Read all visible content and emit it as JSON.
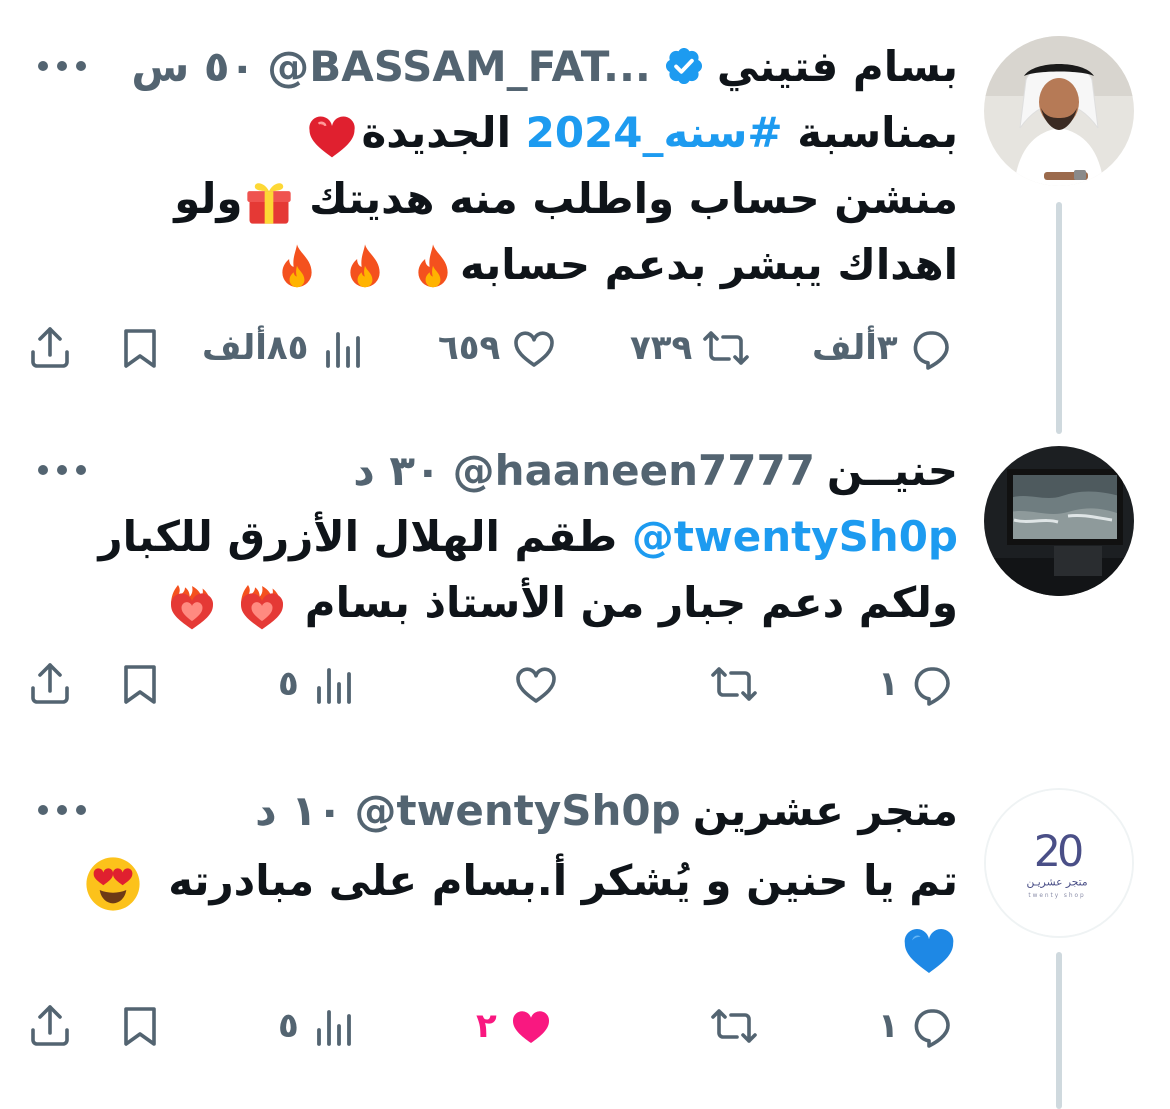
{
  "tweets": [
    {
      "name": "بسام فتيني",
      "handle": "@BASSAM_FAT...",
      "time": "٥٠ س",
      "line1_a": "بمناسبة ",
      "line1_link": "#سنه_2024",
      "line1_b": " الجديدة",
      "line2": "منشن حساب واطلب منه هديتك",
      "line2_b": "ولو",
      "line3": "اهداك يبشر بدعم حسابه",
      "replies": "٣ألف",
      "retweets": "٧٣٩",
      "likes": "٦٥٩",
      "views": "٨٥ألف"
    },
    {
      "name": "حنيــن",
      "handle": "@haaneen7777",
      "time": "٣٠ د",
      "mention": "@twentySh0p",
      "line1": " طقم الهلال الأزرق للكبار",
      "line2": "ولكم دعم جبار من الأستاذ بسام",
      "replies": "١",
      "retweets": "",
      "likes": "",
      "views": "٥"
    },
    {
      "name": "متجر عشرين",
      "handle": "@twentySh0p",
      "time": "١٠ د",
      "line1": "تم يا حنين و يُشكر أ.بسام على مبادرته",
      "replies": "١",
      "retweets": "",
      "likes": "٢",
      "views": "٥",
      "logo_text": "متجر عشريـن",
      "logo_sub": "twenty shop"
    }
  ],
  "colors": {
    "link": "#1d9bf0",
    "verified": "#1d9bf0",
    "like_active": "#f91880",
    "muted": "#536471",
    "thread_line": "#cfd9de"
  },
  "icons": [
    "reply-icon",
    "retweet-icon",
    "like-icon",
    "views-icon",
    "bookmark-icon",
    "share-icon",
    "verified-icon",
    "more-icon"
  ]
}
